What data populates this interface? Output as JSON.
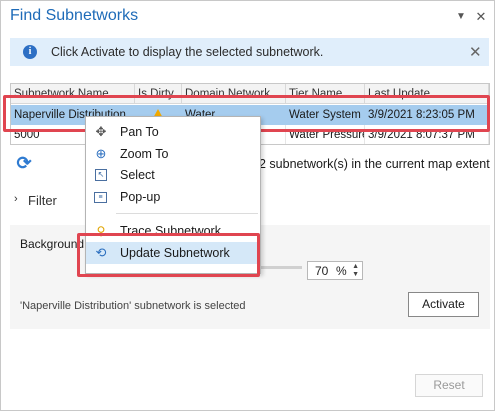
{
  "window": {
    "title": "Find Subnetworks",
    "pin_glyph": "▼",
    "close_glyph": "✕"
  },
  "info_bar": {
    "icon": "info-icon",
    "text": "Click Activate to display the selected subnetwork.",
    "dismiss_glyph": "✕",
    "background": "#e0eefb"
  },
  "table": {
    "columns": [
      "Subnetwork Name",
      "Is Dirty",
      "Domain Network",
      "Tier Name",
      "Last Update"
    ],
    "rows": [
      {
        "name": "Naperville Distribution",
        "is_dirty": "warning-icon",
        "domain": "Water",
        "tier": "Water System",
        "last_update": "3/9/2021 8:23:05 PM",
        "selected": true
      },
      {
        "name": "5000",
        "is_dirty": "",
        "domain": "",
        "tier": "Water Pressure",
        "last_update": "3/9/2021 8:07:37 PM",
        "selected": false
      }
    ],
    "selected_row_color": "#a5ccee"
  },
  "refresh_glyph": "⟳",
  "count_text": "2 subnetwork(s) in the current map extent",
  "filter": {
    "label": "Filter",
    "chevron": "›",
    "expanded": false
  },
  "background": {
    "label": "Background",
    "zoom_value": "70",
    "zoom_unit": "%",
    "spin_up": "▲",
    "spin_down": "▼"
  },
  "status_text": "'Naperville Distribution' subnetwork is selected",
  "buttons": {
    "activate": "Activate",
    "reset": "Reset"
  },
  "context_menu": {
    "items": [
      {
        "label": "Pan To",
        "icon": "pan-icon",
        "glyph": "✥"
      },
      {
        "label": "Zoom To",
        "icon": "zoom-in-icon",
        "glyph": "⊕"
      },
      {
        "label": "Select",
        "icon": "select-icon",
        "glyph": "↖"
      },
      {
        "label": "Pop-up",
        "icon": "popup-icon",
        "glyph": "≡"
      },
      {
        "label": "Trace Subnetwork",
        "icon": "trace-icon",
        "glyph": "⚲"
      },
      {
        "label": "Update Subnetwork",
        "icon": "update-icon",
        "glyph": "⟲"
      }
    ],
    "hovered_index": 5
  },
  "colors": {
    "title_blue": "#1e6bb8",
    "annotation_red": "#e04550",
    "accent_blue": "#2f7bd1"
  }
}
